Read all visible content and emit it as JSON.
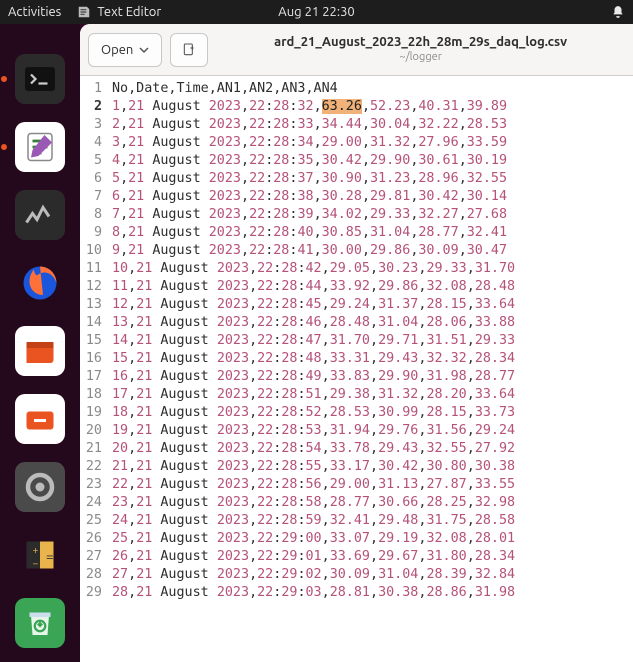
{
  "panel": {
    "activities": "Activities",
    "app_name": "Text Editor",
    "clock": "Aug 21  22:30"
  },
  "editor": {
    "open_label": "Open",
    "filename": "ard_21_August_2023_22h_28m_29s_daq_log.csv",
    "filepath": "~/logger",
    "header_line": "No,Date,Time,AN1,AN2,AN3,AN4",
    "rows": [
      {
        "no": "1",
        "date": "21 August 2023",
        "time": "22:28:32",
        "a1": "63.26",
        "a2": "52.23",
        "a3": "40.31",
        "a4": "39.89",
        "sel": true
      },
      {
        "no": "2",
        "date": "21 August 2023",
        "time": "22:28:33",
        "a1": "34.44",
        "a2": "30.04",
        "a3": "32.22",
        "a4": "28.53"
      },
      {
        "no": "3",
        "date": "21 August 2023",
        "time": "22:28:34",
        "a1": "29.00",
        "a2": "31.32",
        "a3": "27.96",
        "a4": "33.59"
      },
      {
        "no": "4",
        "date": "21 August 2023",
        "time": "22:28:35",
        "a1": "30.42",
        "a2": "29.90",
        "a3": "30.61",
        "a4": "30.19"
      },
      {
        "no": "5",
        "date": "21 August 2023",
        "time": "22:28:37",
        "a1": "30.90",
        "a2": "31.23",
        "a3": "28.96",
        "a4": "32.55"
      },
      {
        "no": "6",
        "date": "21 August 2023",
        "time": "22:28:38",
        "a1": "30.28",
        "a2": "29.81",
        "a3": "30.42",
        "a4": "30.14"
      },
      {
        "no": "7",
        "date": "21 August 2023",
        "time": "22:28:39",
        "a1": "34.02",
        "a2": "29.33",
        "a3": "32.27",
        "a4": "27.68"
      },
      {
        "no": "8",
        "date": "21 August 2023",
        "time": "22:28:40",
        "a1": "30.85",
        "a2": "31.04",
        "a3": "28.77",
        "a4": "32.41"
      },
      {
        "no": "9",
        "date": "21 August 2023",
        "time": "22:28:41",
        "a1": "30.00",
        "a2": "29.86",
        "a3": "30.09",
        "a4": "30.47"
      },
      {
        "no": "10",
        "date": "21 August 2023",
        "time": "22:28:42",
        "a1": "29.05",
        "a2": "30.23",
        "a3": "29.33",
        "a4": "31.70"
      },
      {
        "no": "11",
        "date": "21 August 2023",
        "time": "22:28:44",
        "a1": "33.92",
        "a2": "29.86",
        "a3": "32.08",
        "a4": "28.48"
      },
      {
        "no": "12",
        "date": "21 August 2023",
        "time": "22:28:45",
        "a1": "29.24",
        "a2": "31.37",
        "a3": "28.15",
        "a4": "33.64"
      },
      {
        "no": "13",
        "date": "21 August 2023",
        "time": "22:28:46",
        "a1": "28.48",
        "a2": "31.04",
        "a3": "28.06",
        "a4": "33.88"
      },
      {
        "no": "14",
        "date": "21 August 2023",
        "time": "22:28:47",
        "a1": "31.70",
        "a2": "29.71",
        "a3": "31.51",
        "a4": "29.33"
      },
      {
        "no": "15",
        "date": "21 August 2023",
        "time": "22:28:48",
        "a1": "33.31",
        "a2": "29.43",
        "a3": "32.32",
        "a4": "28.34"
      },
      {
        "no": "16",
        "date": "21 August 2023",
        "time": "22:28:49",
        "a1": "33.83",
        "a2": "29.90",
        "a3": "31.98",
        "a4": "28.77"
      },
      {
        "no": "17",
        "date": "21 August 2023",
        "time": "22:28:51",
        "a1": "29.38",
        "a2": "31.32",
        "a3": "28.20",
        "a4": "33.64"
      },
      {
        "no": "18",
        "date": "21 August 2023",
        "time": "22:28:52",
        "a1": "28.53",
        "a2": "30.99",
        "a3": "28.15",
        "a4": "33.73"
      },
      {
        "no": "19",
        "date": "21 August 2023",
        "time": "22:28:53",
        "a1": "31.94",
        "a2": "29.76",
        "a3": "31.56",
        "a4": "29.24"
      },
      {
        "no": "20",
        "date": "21 August 2023",
        "time": "22:28:54",
        "a1": "33.78",
        "a2": "29.43",
        "a3": "32.55",
        "a4": "27.92"
      },
      {
        "no": "21",
        "date": "21 August 2023",
        "time": "22:28:55",
        "a1": "33.17",
        "a2": "30.42",
        "a3": "30.80",
        "a4": "30.38"
      },
      {
        "no": "22",
        "date": "21 August 2023",
        "time": "22:28:56",
        "a1": "29.00",
        "a2": "31.13",
        "a3": "27.87",
        "a4": "33.55"
      },
      {
        "no": "23",
        "date": "21 August 2023",
        "time": "22:28:58",
        "a1": "28.77",
        "a2": "30.66",
        "a3": "28.25",
        "a4": "32.98"
      },
      {
        "no": "24",
        "date": "21 August 2023",
        "time": "22:28:59",
        "a1": "32.41",
        "a2": "29.48",
        "a3": "31.75",
        "a4": "28.58"
      },
      {
        "no": "25",
        "date": "21 August 2023",
        "time": "22:29:00",
        "a1": "33.07",
        "a2": "29.19",
        "a3": "32.08",
        "a4": "28.01"
      },
      {
        "no": "26",
        "date": "21 August 2023",
        "time": "22:29:01",
        "a1": "33.69",
        "a2": "29.67",
        "a3": "31.80",
        "a4": "28.34"
      },
      {
        "no": "27",
        "date": "21 August 2023",
        "time": "22:29:02",
        "a1": "30.09",
        "a2": "31.04",
        "a3": "28.39",
        "a4": "32.84"
      },
      {
        "no": "28",
        "date": "21 August 2023",
        "time": "22:29:03",
        "a1": "28.81",
        "a2": "30.38",
        "a3": "28.86",
        "a4": "31.98"
      }
    ]
  }
}
